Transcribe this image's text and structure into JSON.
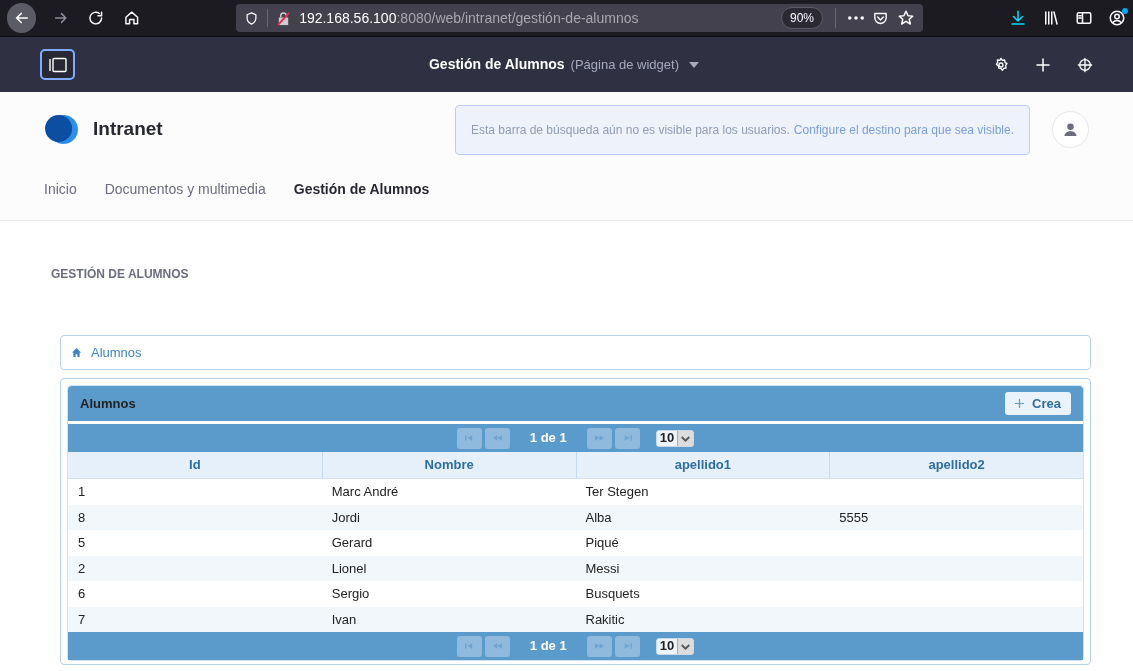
{
  "browser": {
    "url_host": "192.168.56.100",
    "url_rest": ":8080/web/intranet/gestión-de-alumnos",
    "zoom": "90%"
  },
  "admin_bar": {
    "title": "Gestión de Alumnos",
    "subtitle": "(Página de widget)"
  },
  "site": {
    "name": "Intranet",
    "search_notice": "Esta barra de búsqueda aún no es visible para los usuarios.",
    "search_notice_link": "Configure el destino para que sea visible."
  },
  "nav": [
    {
      "label": "Inicio",
      "selected": false
    },
    {
      "label": "Documentos y multimedia",
      "selected": false
    },
    {
      "label": "Gestión de Alumnos",
      "selected": true
    }
  ],
  "page_heading": "GESTIÓN DE ALUMNOS",
  "breadcrumb": "Alumnos",
  "table": {
    "title": "Alumnos",
    "create_button": "Crea",
    "pager_top": {
      "text": "1 de 1",
      "page_size": "10"
    },
    "pager_bottom": {
      "text": "1 de 1",
      "page_size": "10"
    },
    "columns": [
      "Id",
      "Nombre",
      "apellido1",
      "apellido2"
    ],
    "rows": [
      [
        "1",
        "Marc André",
        "Ter Stegen",
        ""
      ],
      [
        "8",
        "Jordi",
        "Alba",
        "5555"
      ],
      [
        "5",
        "Gerard",
        "Piqué",
        ""
      ],
      [
        "2",
        "Lionel",
        "Messi",
        ""
      ],
      [
        "6",
        "Sergio",
        "Busquets",
        ""
      ],
      [
        "7",
        "Ivan",
        "Rakitic",
        ""
      ]
    ]
  }
}
